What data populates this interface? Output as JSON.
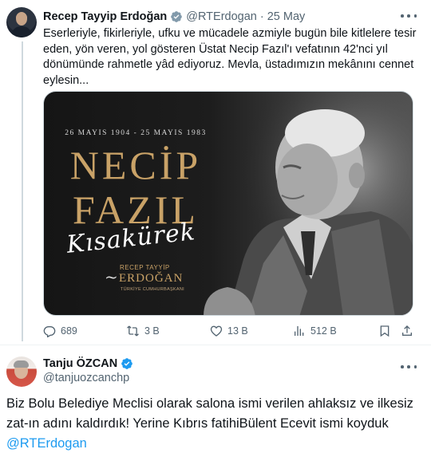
{
  "tweet1": {
    "author_name": "Recep Tayyip Erdoğan",
    "author_handle": "@RTErdogan",
    "separator": "·",
    "date": "25 May",
    "text": "Eserleriyle, fikirleriyle, ufku ve mücadele azmiyle bugün bile kitlelere tesir eden, yön veren, yol gösteren Üstat Necip Fazıl'ı vefatının 42'nci yıl dönümünde rahmetle yâd ediyoruz. Mevla, üstadımızın mekânını cennet eylesin...",
    "media": {
      "dates": "26 MAYIS 1904 - 25 MAYIS 1983",
      "title_line1": "NECİP",
      "title_line2": "FAZIL",
      "signature": "Kısakürek",
      "sig_small": "RECEP TAYYİP",
      "sig_big": "ERDOĞAN",
      "sig_title": "TÜRKİYE CUMHURBAŞKANI"
    },
    "actions": {
      "replies": "689",
      "reposts": "3 B",
      "likes": "13 B",
      "views": "512 B"
    },
    "icons": [
      "verified-badge-icon",
      "more-icon",
      "reply-icon",
      "repost-icon",
      "like-icon",
      "views-icon",
      "bookmark-icon",
      "share-icon"
    ]
  },
  "tweet2": {
    "author_name": "Tanju ÖZCAN",
    "author_handle": "@tanjuozcanchp",
    "text": "Biz Bolu Belediye Meclisi olarak salona ismi verilen ahlaksız ve ilkesiz zat-ın adını kaldırdık! Yerine Kıbrıs fatihiBülent Ecevit ismi koyduk",
    "mention": "@RTErdogan"
  },
  "colors": {
    "accent": "#1d9bf0",
    "secondary_text": "#536471",
    "gold": "#c9a267",
    "badge_gray": "#829aab"
  }
}
